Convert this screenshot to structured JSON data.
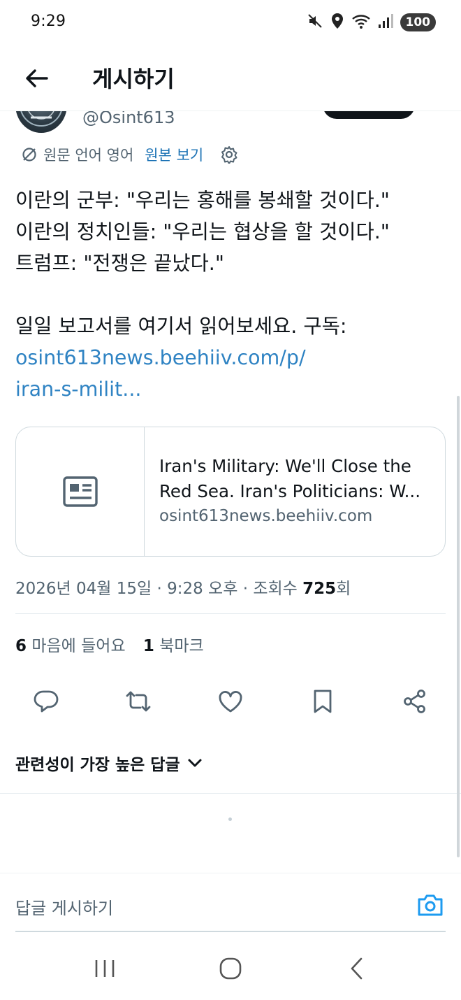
{
  "status_bar": {
    "time": "9:29",
    "battery": "100",
    "icons": [
      "mute-icon",
      "location-icon",
      "wifi-icon",
      "signal-icon"
    ]
  },
  "header": {
    "title": "게시하기",
    "back_icon": "back-arrow-icon"
  },
  "author": {
    "handle": "@Osint613"
  },
  "translate": {
    "info": "원문 언어 영어",
    "link": "원본 보기"
  },
  "tweet": {
    "lines": [
      "이란의 군부: \"우리는 홍해를 봉쇄할 것이다.\"",
      "이란의 정치인들: \"우리는 협상을 할 것이다.\"",
      "트럼프: \"전쟁은 끝났다.\"",
      "",
      "일일 보고서를 여기서 읽어보세요. 구독:"
    ],
    "link_line1": "osint613news.beehiiv.com/p/",
    "link_line2": "iran-s-milit..."
  },
  "card": {
    "title": "Iran's Military: We'll Close the Red Sea. Iran's Politicians: W...",
    "domain": "osint613news.beehiiv.com"
  },
  "meta": {
    "prefix": "2026년 04월 15일 · 9:28 오후 · 조회수 ",
    "views": "725",
    "suffix": "회"
  },
  "stats": {
    "likes_count": "6",
    "likes_label": " 마음에 들어요",
    "bookmarks_count": "1",
    "bookmarks_label": " 북마크"
  },
  "sort": {
    "label": "관련성이 가장 높은 답글"
  },
  "reply": {
    "placeholder": "답글 게시하기"
  },
  "colors": {
    "link": "#2f83c3",
    "secondary_text": "#536471",
    "primary_text": "#0f1419",
    "border": "#cfd9de"
  }
}
